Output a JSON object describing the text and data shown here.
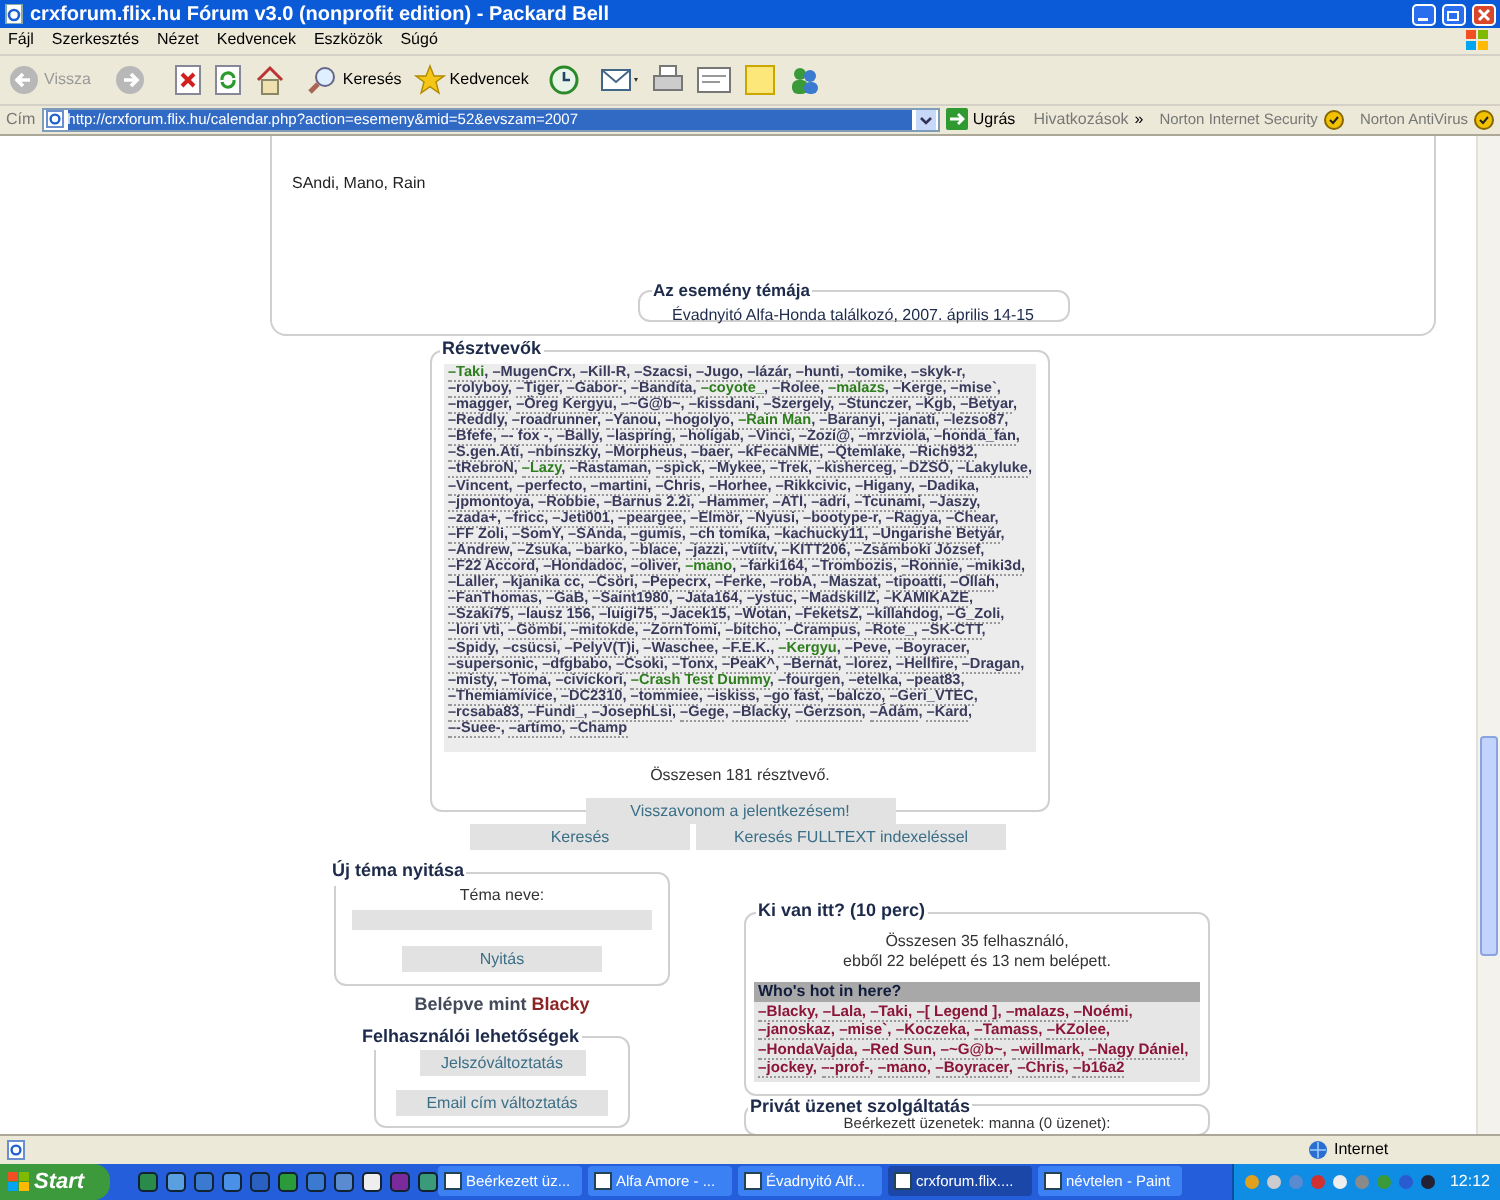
{
  "window": {
    "title": "crxforum.flix.hu Fórum v3.0 (nonprofit edition) - Packard Bell"
  },
  "menu": [
    "Fájl",
    "Szerkesztés",
    "Nézet",
    "Kedvencek",
    "Eszközök",
    "Súgó"
  ],
  "toolbar": {
    "back": "Vissza",
    "search": "Keresés",
    "favorites": "Kedvencek"
  },
  "address_bar": {
    "label": "Cím",
    "url": "http://crxforum.flix.hu/calendar.php?action=esemeny&mid=52&evszam=2007",
    "go": "Ugrás",
    "links": "Hivatkozások",
    "chevron": "»",
    "toolbars": [
      "Norton Internet Security",
      "Norton AntiVirus"
    ]
  },
  "page": {
    "attendees_text": "SAndi, Mano, Rain",
    "topic": {
      "legend": "Az esemény témája",
      "text": "Évadnyitó Alfa-Honda találkozó, 2007. április 14-15"
    },
    "participants": {
      "legend": "Résztvevők",
      "items": [
        {
          "name": "–Taki",
          "color": "#2e7d1e"
        },
        {
          "name": "–MugenCrx",
          "color": "#3a3a5c"
        },
        {
          "name": "–Kill-R",
          "color": "#3a3a5c"
        },
        {
          "name": "–Szacsi",
          "color": "#3a3a5c"
        },
        {
          "name": "–Jugo",
          "color": "#3a3a5c"
        },
        {
          "name": "–lázár",
          "color": "#3a3a5c"
        },
        {
          "name": "–hunti",
          "color": "#3a3a5c"
        },
        {
          "name": "–tomike",
          "color": "#3a3a5c"
        },
        {
          "name": "–skyk-r",
          "color": "#3a3a5c"
        },
        {
          "name": "–rolyboy",
          "color": "#3a3a5c"
        },
        {
          "name": "–Tiger",
          "color": "#3a3a5c"
        },
        {
          "name": "–Gabor-",
          "color": "#3a3a5c"
        },
        {
          "name": "–Bandita",
          "color": "#3a3a5c"
        },
        {
          "name": "–coyote_",
          "color": "#2e7d1e"
        },
        {
          "name": "–Rolee",
          "color": "#3a3a5c"
        },
        {
          "name": "–malazs",
          "color": "#2e7d1e"
        },
        {
          "name": "–Kerge",
          "color": "#3a3a5c"
        },
        {
          "name": "–mise`",
          "color": "#3a3a5c"
        },
        {
          "name": "–magger",
          "color": "#3a3a5c"
        },
        {
          "name": "–Öreg Kergyu",
          "color": "#3a3a5c"
        },
        {
          "name": "–~G@b~",
          "color": "#3a3a5c"
        },
        {
          "name": "–kissdani",
          "color": "#3a3a5c"
        },
        {
          "name": "–Szergely",
          "color": "#3a3a5c"
        },
        {
          "name": "–Stunczer",
          "color": "#3a3a5c"
        },
        {
          "name": "–Kgb",
          "color": "#3a3a5c"
        },
        {
          "name": "–Betyar",
          "color": "#3a3a5c"
        },
        {
          "name": "–Reddly",
          "color": "#3a3a5c"
        },
        {
          "name": "–roadrunner",
          "color": "#3a3a5c"
        },
        {
          "name": "–Yanou",
          "color": "#3a3a5c"
        },
        {
          "name": "–hogolyo",
          "color": "#3a3a5c"
        },
        {
          "name": "–Rain Man",
          "color": "#2e7d1e"
        },
        {
          "name": "–Baranyi",
          "color": "#3a3a5c"
        },
        {
          "name": "–janati",
          "color": "#3a3a5c"
        },
        {
          "name": "–lezso87",
          "color": "#3a3a5c"
        },
        {
          "name": "–Bfefe",
          "color": "#3a3a5c"
        },
        {
          "name": "–- fox -",
          "color": "#3a3a5c"
        },
        {
          "name": "–Bally",
          "color": "#3a3a5c"
        },
        {
          "name": "–laspring",
          "color": "#3a3a5c"
        },
        {
          "name": "–holigab",
          "color": "#3a3a5c"
        },
        {
          "name": "–Vinci",
          "color": "#3a3a5c"
        },
        {
          "name": "–Zozi@",
          "color": "#3a3a5c"
        },
        {
          "name": "–mrzviola",
          "color": "#3a3a5c"
        },
        {
          "name": "–honda_fan",
          "color": "#3a3a5c"
        },
        {
          "name": "–S.gen.Ati",
          "color": "#3a3a5c"
        },
        {
          "name": "–nbinszky",
          "color": "#3a3a5c"
        },
        {
          "name": "–Morpheus",
          "color": "#3a3a5c"
        },
        {
          "name": "–baer",
          "color": "#3a3a5c"
        },
        {
          "name": "–kFecaNME",
          "color": "#3a3a5c"
        },
        {
          "name": "–Qtemlake",
          "color": "#3a3a5c"
        },
        {
          "name": "–Rich932",
          "color": "#3a3a5c"
        },
        {
          "name": "–tRebroN",
          "color": "#3a3a5c"
        },
        {
          "name": "–Lazy",
          "color": "#2e7d1e"
        },
        {
          "name": "–Rastaman",
          "color": "#3a3a5c"
        },
        {
          "name": "–spick",
          "color": "#3a3a5c"
        },
        {
          "name": "–Mykee",
          "color": "#3a3a5c"
        },
        {
          "name": "–Trek",
          "color": "#3a3a5c"
        },
        {
          "name": "–kisherceg",
          "color": "#3a3a5c"
        },
        {
          "name": "–DZSÖ",
          "color": "#3a3a5c"
        },
        {
          "name": "–Lakyluke",
          "color": "#3a3a5c"
        },
        {
          "name": "–Vincent",
          "color": "#3a3a5c"
        },
        {
          "name": "–perfecto",
          "color": "#3a3a5c"
        },
        {
          "name": "–martini",
          "color": "#3a3a5c"
        },
        {
          "name": "–Chris",
          "color": "#3a3a5c"
        },
        {
          "name": "–Horhee",
          "color": "#3a3a5c"
        },
        {
          "name": "–Rikkcivic",
          "color": "#3a3a5c"
        },
        {
          "name": "–Higany",
          "color": "#3a3a5c"
        },
        {
          "name": "–Dadika",
          "color": "#3a3a5c"
        },
        {
          "name": "–jpmontoya",
          "color": "#3a3a5c"
        },
        {
          "name": "–Robbie",
          "color": "#3a3a5c"
        },
        {
          "name": "–Barnus 2.2i",
          "color": "#3a3a5c"
        },
        {
          "name": "–Hammer",
          "color": "#3a3a5c"
        },
        {
          "name": "–ATI",
          "color": "#3a3a5c"
        },
        {
          "name": "–adri",
          "color": "#3a3a5c"
        },
        {
          "name": "–Tcunami",
          "color": "#3a3a5c"
        },
        {
          "name": "–Jaszy",
          "color": "#3a3a5c"
        },
        {
          "name": "–zada+",
          "color": "#3a3a5c"
        },
        {
          "name": "–fricc",
          "color": "#3a3a5c"
        },
        {
          "name": "–Jeti001",
          "color": "#3a3a5c"
        },
        {
          "name": "–peargee",
          "color": "#3a3a5c"
        },
        {
          "name": "–Elmör",
          "color": "#3a3a5c"
        },
        {
          "name": "–Nyusi",
          "color": "#3a3a5c"
        },
        {
          "name": "–bootype-r",
          "color": "#3a3a5c"
        },
        {
          "name": "–Ragya",
          "color": "#3a3a5c"
        },
        {
          "name": "–Chear",
          "color": "#3a3a5c"
        },
        {
          "name": "–FF Zoli",
          "color": "#3a3a5c"
        },
        {
          "name": "–SomY",
          "color": "#3a3a5c"
        },
        {
          "name": "–SAnda",
          "color": "#3a3a5c"
        },
        {
          "name": "–gumis",
          "color": "#3a3a5c"
        },
        {
          "name": "–ch tomika",
          "color": "#3a3a5c"
        },
        {
          "name": "–kachucky11",
          "color": "#3a3a5c"
        },
        {
          "name": "–Ungarishe Betyár",
          "color": "#3a3a5c"
        },
        {
          "name": "–Andrew",
          "color": "#3a3a5c"
        },
        {
          "name": "–Zsuka",
          "color": "#3a3a5c"
        },
        {
          "name": "–barko",
          "color": "#3a3a5c"
        },
        {
          "name": "–blace",
          "color": "#3a3a5c"
        },
        {
          "name": "–jazzi",
          "color": "#3a3a5c"
        },
        {
          "name": "–vtiitv",
          "color": "#3a3a5c"
        },
        {
          "name": "–KITT206",
          "color": "#3a3a5c"
        },
        {
          "name": "–Zsámboki József",
          "color": "#3a3a5c"
        },
        {
          "name": "–F22 Accord",
          "color": "#3a3a5c"
        },
        {
          "name": "–Hondadoc",
          "color": "#3a3a5c"
        },
        {
          "name": "–oliver",
          "color": "#3a3a5c"
        },
        {
          "name": "–mano",
          "color": "#2e7d1e"
        },
        {
          "name": "–farki164",
          "color": "#3a3a5c"
        },
        {
          "name": "–Trombozis",
          "color": "#3a3a5c"
        },
        {
          "name": "–Ronnie",
          "color": "#3a3a5c"
        },
        {
          "name": "–miki3d",
          "color": "#3a3a5c"
        },
        {
          "name": "–Laller",
          "color": "#3a3a5c"
        },
        {
          "name": "–kjanika cc",
          "color": "#3a3a5c"
        },
        {
          "name": "–Csöri",
          "color": "#3a3a5c"
        },
        {
          "name": "–Pepecrx",
          "color": "#3a3a5c"
        },
        {
          "name": "–Ferke",
          "color": "#3a3a5c"
        },
        {
          "name": "–robA",
          "color": "#3a3a5c"
        },
        {
          "name": "–Maszat",
          "color": "#3a3a5c"
        },
        {
          "name": "–tipoatti",
          "color": "#3a3a5c"
        },
        {
          "name": "–Ollah",
          "color": "#3a3a5c"
        },
        {
          "name": "–FanThomas",
          "color": "#3a3a5c"
        },
        {
          "name": "–GaB",
          "color": "#3a3a5c"
        },
        {
          "name": "–Saint1980",
          "color": "#3a3a5c"
        },
        {
          "name": "–Jata164",
          "color": "#3a3a5c"
        },
        {
          "name": "–ystuc",
          "color": "#3a3a5c"
        },
        {
          "name": "–MadskillZ",
          "color": "#3a3a5c"
        },
        {
          "name": "–KAMIKAZE",
          "color": "#3a3a5c"
        },
        {
          "name": "–Szaki75",
          "color": "#3a3a5c"
        },
        {
          "name": "–lausz 156",
          "color": "#3a3a5c"
        },
        {
          "name": "–luigi75",
          "color": "#3a3a5c"
        },
        {
          "name": "–Jacek15",
          "color": "#3a3a5c"
        },
        {
          "name": "–Wotan",
          "color": "#3a3a5c"
        },
        {
          "name": "–FeketsZ",
          "color": "#3a3a5c"
        },
        {
          "name": "–killahdog",
          "color": "#3a3a5c"
        },
        {
          "name": "–G_Zoli",
          "color": "#3a3a5c"
        },
        {
          "name": "–lori vti",
          "color": "#3a3a5c"
        },
        {
          "name": "–Gömbi",
          "color": "#3a3a5c"
        },
        {
          "name": "–mitokde",
          "color": "#3a3a5c"
        },
        {
          "name": "–ZornTomi",
          "color": "#3a3a5c"
        },
        {
          "name": "–bitcho",
          "color": "#3a3a5c"
        },
        {
          "name": "–Crampus",
          "color": "#3a3a5c"
        },
        {
          "name": "–Rote_",
          "color": "#3a3a5c"
        },
        {
          "name": "–SK-CTT",
          "color": "#3a3a5c"
        },
        {
          "name": "–Spidy",
          "color": "#3a3a5c"
        },
        {
          "name": "–csücsi",
          "color": "#3a3a5c"
        },
        {
          "name": "–PelyV(T)i",
          "color": "#3a3a5c"
        },
        {
          "name": "–Waschee",
          "color": "#3a3a5c"
        },
        {
          "name": "–F.E.K.",
          "color": "#3a3a5c"
        },
        {
          "name": "–Kergyu",
          "color": "#2e7d1e"
        },
        {
          "name": "–Peve",
          "color": "#3a3a5c"
        },
        {
          "name": "–Boyracer",
          "color": "#3a3a5c"
        },
        {
          "name": "–supersonic",
          "color": "#3a3a5c"
        },
        {
          "name": "–dfgbabo",
          "color": "#3a3a5c"
        },
        {
          "name": "–Csoki",
          "color": "#3a3a5c"
        },
        {
          "name": "–Tonx",
          "color": "#3a3a5c"
        },
        {
          "name": "–PeaK^",
          "color": "#3a3a5c"
        },
        {
          "name": "–Bernát",
          "color": "#3a3a5c"
        },
        {
          "name": "–lorez",
          "color": "#3a3a5c"
        },
        {
          "name": "–Hellfire",
          "color": "#3a3a5c"
        },
        {
          "name": "–Dragan",
          "color": "#3a3a5c"
        },
        {
          "name": "–misty",
          "color": "#3a3a5c"
        },
        {
          "name": "–Toma",
          "color": "#3a3a5c"
        },
        {
          "name": "–civickori",
          "color": "#3a3a5c"
        },
        {
          "name": "–Crash Test Dummy",
          "color": "#2e7d1e"
        },
        {
          "name": "–fourgen",
          "color": "#3a3a5c"
        },
        {
          "name": "–etelka",
          "color": "#3a3a5c"
        },
        {
          "name": "–peat83",
          "color": "#3a3a5c"
        },
        {
          "name": "–Themiamivice",
          "color": "#3a3a5c"
        },
        {
          "name": "–DC2310",
          "color": "#3a3a5c"
        },
        {
          "name": "–tommiee",
          "color": "#3a3a5c"
        },
        {
          "name": "–iskiss",
          "color": "#3a3a5c"
        },
        {
          "name": "–go fast",
          "color": "#3a3a5c"
        },
        {
          "name": "–balczo",
          "color": "#3a3a5c"
        },
        {
          "name": "–Geri_VTEC",
          "color": "#3a3a5c"
        },
        {
          "name": "–rcsaba83",
          "color": "#3a3a5c"
        },
        {
          "name": "–Fundi_",
          "color": "#3a3a5c"
        },
        {
          "name": "–JosephLsi",
          "color": "#3a3a5c"
        },
        {
          "name": "–Gege",
          "color": "#3a3a5c"
        },
        {
          "name": "–Blacky",
          "color": "#3a3a5c"
        },
        {
          "name": "–Gerzson",
          "color": "#3a3a5c"
        },
        {
          "name": "–Ádám",
          "color": "#3a3a5c"
        },
        {
          "name": "–Kard",
          "color": "#3a3a5c"
        },
        {
          "name": "–-Suee-",
          "color": "#3a3a5c"
        },
        {
          "name": "–artimo",
          "color": "#3a3a5c"
        },
        {
          "name": "–Champ",
          "color": "#3a3a5c"
        }
      ],
      "separator": ",",
      "total": "Összesen 181 résztvevő.",
      "button": "Visszavonom a jelentkezésem!"
    },
    "search_buttons": [
      "Keresés",
      "Keresés FULLTEXT indexeléssel"
    ],
    "new_topic": {
      "legend": "Új téma nyitása",
      "label": "Téma neve:",
      "button": "Nyitás"
    },
    "logged_in": {
      "prefix": "Belépve mint",
      "user": "Blacky"
    },
    "user_options": {
      "legend": "Felhasználói lehetőségek",
      "buttons": [
        "Jelszóváltoztatás",
        "Email cím változtatás"
      ]
    },
    "who": {
      "legend": "Ki van itt? (10 perc)",
      "summary": [
        "Összesen 35 felhasználó,",
        "ebből 22 belépett és 13 nem belépett."
      ],
      "hot_title": "Who's hot in here?",
      "users": [
        "–Blacky",
        "–Lala",
        "–Taki",
        "–[ Legend ]",
        "–malazs",
        "–Noémi",
        "–janoskaz",
        "–mise`",
        "–Koczeka",
        "–Tamass",
        "–KZolee",
        "–HondaVajda",
        "–Red Sun",
        "–~G@b~",
        "–willmark",
        "–Nagy Dániel",
        "–jockey",
        "–-prof-",
        "–mano",
        "–Boyracer",
        "–Chris",
        "–b16a2"
      ],
      "separator": ","
    },
    "private": {
      "legend": "Privát üzenet szolgáltatás",
      "text": "Beérkezett üzenetek: manna (0 üzenet):"
    }
  },
  "status_bar": {
    "zone": "Internet"
  },
  "taskbar": {
    "start": "Start",
    "tasks": [
      {
        "label": "Beérkezett üz...",
        "selected": false
      },
      {
        "label": "Alfa Amore - ...",
        "selected": false
      },
      {
        "label": "Évadnyitó Alf...",
        "selected": false
      },
      {
        "label": "crxforum.flix....",
        "selected": true
      },
      {
        "label": "névtelen - Paint",
        "selected": false
      }
    ],
    "clock": "12:12"
  }
}
